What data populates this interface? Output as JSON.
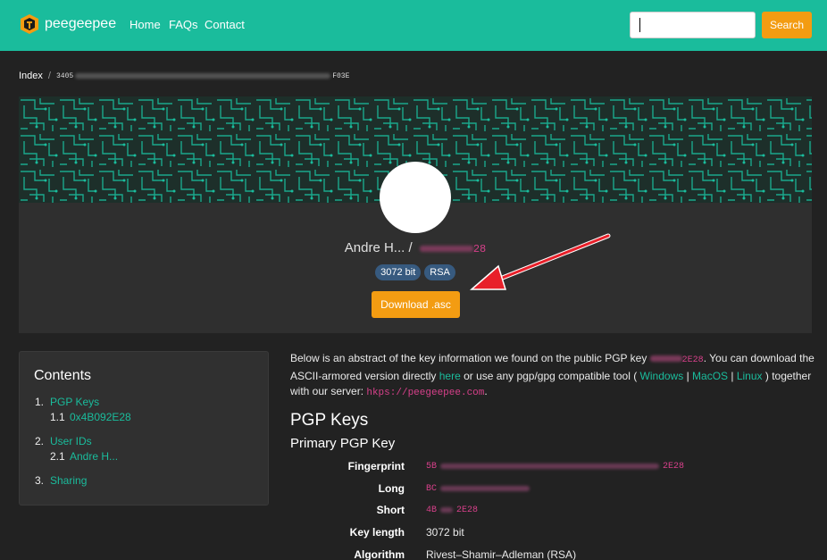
{
  "nav": {
    "brand": "peegeepee",
    "links": [
      "Home",
      "FAQs",
      "Contact"
    ],
    "search_value": "",
    "search_button": "Search"
  },
  "breadcrumb": {
    "index": "Index",
    "sep": "/",
    "id_start": "3405",
    "id_end": "F03E"
  },
  "hero": {
    "name": "Andre H... /",
    "id_end": "28",
    "badges": [
      "3072 bit",
      "RSA"
    ],
    "download": "Download .asc"
  },
  "contents": {
    "title": "Contents",
    "items": [
      {
        "num": "1.",
        "label": "PGP Keys",
        "sub": {
          "num": "1.1",
          "label": "0x4B092E28"
        }
      },
      {
        "num": "2.",
        "label": "User IDs",
        "sub": {
          "num": "2.1",
          "label": "Andre H..."
        }
      },
      {
        "num": "3.",
        "label": "Sharing"
      }
    ]
  },
  "intro": {
    "t1": "Below is an abstract of the key information we found on the public PGP key ",
    "key_end": "2E28",
    "t2": ". You can download the ASCII-armored version directly ",
    "here": "here",
    "t3": " or use any pgp/gpg compatible tool ( ",
    "windows": "Windows",
    "sep1": " | ",
    "macos": "MacOS",
    "sep2": " | ",
    "linux": "Linux",
    "t4": " ) together with our server: ",
    "server": "hkps://peegeepee.com",
    "t5": "."
  },
  "keys": {
    "heading": "PGP Keys",
    "primary": "Primary PGP Key",
    "rows": [
      {
        "label": "Fingerprint",
        "start": "5B",
        "end": "2E28"
      },
      {
        "label": "Long",
        "start": "BC",
        "end": ""
      },
      {
        "label": "Short",
        "start": "4B",
        "end": "2E28"
      },
      {
        "label": "Key length",
        "value": "3072 bit"
      },
      {
        "label": "Algorithm",
        "value": "Rivest–Shamir–Adleman (RSA)"
      }
    ]
  },
  "colors": {
    "navbar": "#1abc9c",
    "accent": "#f39c12",
    "background": "#222222",
    "link": "#1abc9c",
    "code": "#d6408a",
    "badge": "#375a7f",
    "annotation_arrow": "#e8202a"
  }
}
